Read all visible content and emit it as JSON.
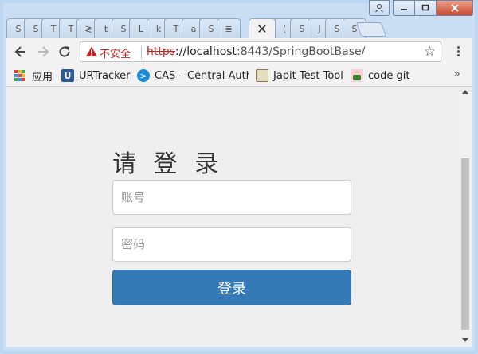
{
  "browser": {
    "tabs": [
      {
        "label": "S"
      },
      {
        "label": "S"
      },
      {
        "label": "T"
      },
      {
        "label": "T"
      },
      {
        "label": "≷"
      },
      {
        "label": "t"
      },
      {
        "label": "S"
      },
      {
        "label": "L"
      },
      {
        "label": "k"
      },
      {
        "label": "T"
      },
      {
        "label": "a"
      },
      {
        "label": "S"
      },
      {
        "label": "≣"
      },
      {
        "label": "✕"
      },
      {
        "label": "("
      },
      {
        "label": "S"
      },
      {
        "label": "J"
      },
      {
        "label": "S"
      },
      {
        "label": "S"
      }
    ],
    "security_label": "不安全",
    "url_scheme": "https",
    "url_rest_host": "://localhost",
    "url_port_path": ":8443/SpringBootBase/",
    "bookmarks": [
      {
        "label": "应用",
        "icon": "apps-grid-icon"
      },
      {
        "label": "URTracker",
        "icon": "urtracker-icon",
        "color": "#2b5a9e"
      },
      {
        "label": "CAS – Central Authe",
        "icon": "cas-icon",
        "color": "#1f8bd6"
      },
      {
        "label": "Japit Test Tool",
        "icon": "japit-icon"
      },
      {
        "label": "code git",
        "icon": "git-icon"
      }
    ],
    "more_bookmarks": "»"
  },
  "login": {
    "title": "请 登 录",
    "account_placeholder": "账号",
    "password_placeholder": "密码",
    "submit_label": "登录"
  },
  "colors": {
    "primary_button": "#337ab7",
    "insecure_red": "#c5221f"
  }
}
